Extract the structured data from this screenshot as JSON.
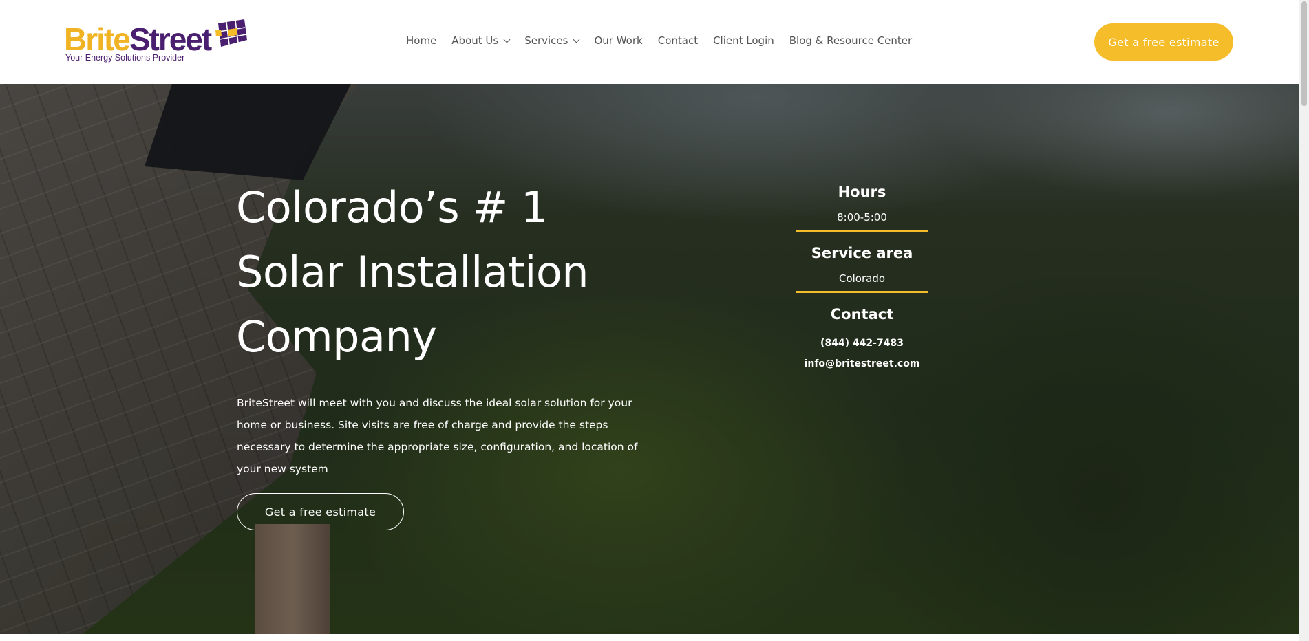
{
  "brand": {
    "logo_part1": "Brite",
    "logo_part2": "Street",
    "tagline": "Your Energy Solutions Provider",
    "colors": {
      "yellow": "#f5bd2a",
      "purple": "#4b1f6f"
    }
  },
  "nav": {
    "items": [
      {
        "label": "Home"
      },
      {
        "label": "About Us",
        "has_dropdown": true
      },
      {
        "label": "Services",
        "has_dropdown": true
      },
      {
        "label": "Our Work"
      },
      {
        "label": "Contact"
      },
      {
        "label": "Client Login"
      },
      {
        "label": "Blog & Resource Center"
      }
    ],
    "cta": "Get a free estimate"
  },
  "hero": {
    "title_lines": [
      "Colorado’s # 1",
      "Solar Installation",
      "Company"
    ],
    "description": "BriteStreet will meet with you and discuss the ideal solar solution for your home or business. Site visits are free of charge and provide the steps necessary to determine the appropriate size, configuration, and location of your new system",
    "cta": "Get a free estimate"
  },
  "info": {
    "hours_heading": "Hours",
    "hours_value": "8:00-5:00",
    "service_heading": "Service area",
    "service_value": "Colorado",
    "contact_heading": "Contact",
    "phone": "(844) 442-7483",
    "email": "info@britestreet.com"
  }
}
